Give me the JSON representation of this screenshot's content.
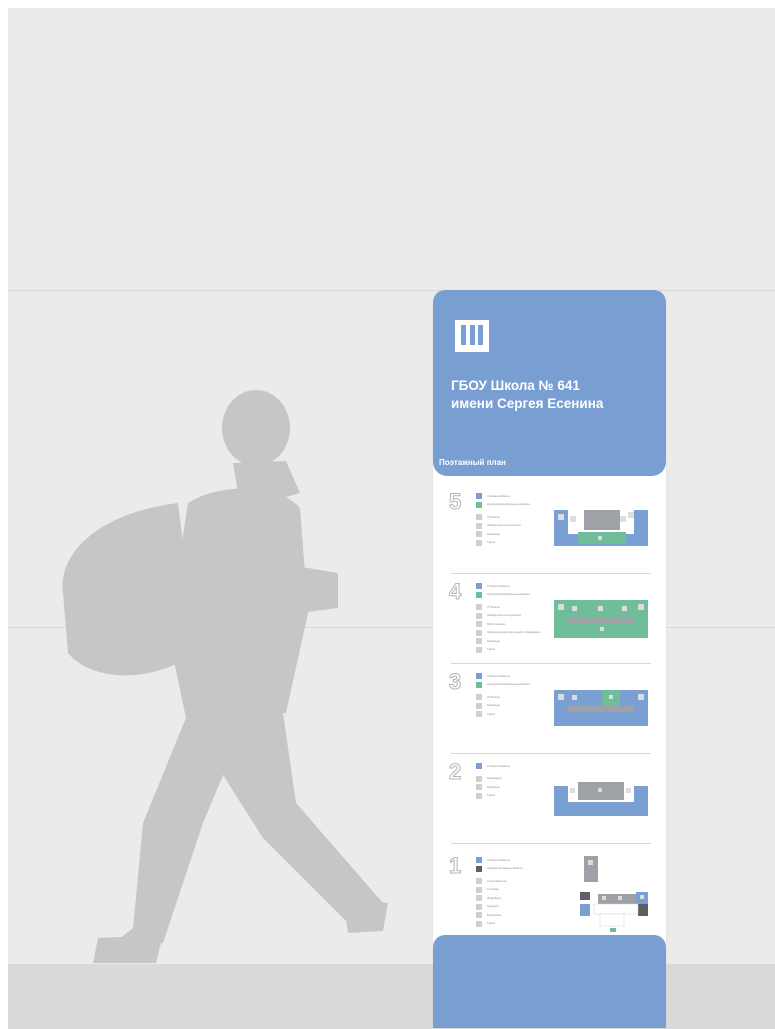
{
  "sign": {
    "school_line1": "ГБОУ Школа № 641",
    "school_line2": "имени Сергея Есенина",
    "plan_title": "Поэтажный план"
  },
  "colors": {
    "brand": "#799ed2",
    "classrooms": "#7a9fd3",
    "specialized": "#6fbd99",
    "service": "#5c6066",
    "background": "#ebebeb"
  },
  "floors": [
    {
      "number": "5",
      "legend_primary": [
        "Учебные кабинеты",
        "Кураторские/профильные кабинеты"
      ],
      "legend_secondary": [
        "IT-Полигон",
        "Лаборатория конструкторов",
        "Рекреация",
        "Туалет"
      ]
    },
    {
      "number": "4",
      "legend_primary": [
        "Учебные кабинеты",
        "Кураторские/профильные кабинеты"
      ],
      "legend_secondary": [
        "IT-Полигон",
        "Лаборатория конструкторов",
        "Робототехника",
        "Лаборатория дополнительного образования",
        "Рекреация",
        "Туалет"
      ]
    },
    {
      "number": "3",
      "legend_primary": [
        "Учебные кабинеты",
        "Кураторские/профильные кабинеты"
      ],
      "legend_secondary": [
        "IT-Полигон",
        "Рекреация",
        "Туалет"
      ]
    },
    {
      "number": "2",
      "legend_primary": [
        "Учебные кабинеты"
      ],
      "legend_secondary": [
        "Медиацентр",
        "Рекреация",
        "Туалет"
      ]
    },
    {
      "number": "1",
      "legend_primary": [
        "Учебные кабинеты",
        "Административные кабинеты"
      ],
      "legend_secondary": [
        "Спортивный зал",
        "Столовая",
        "Медкабинет",
        "Гардероб",
        "Библиотека",
        "Туалет"
      ]
    }
  ]
}
